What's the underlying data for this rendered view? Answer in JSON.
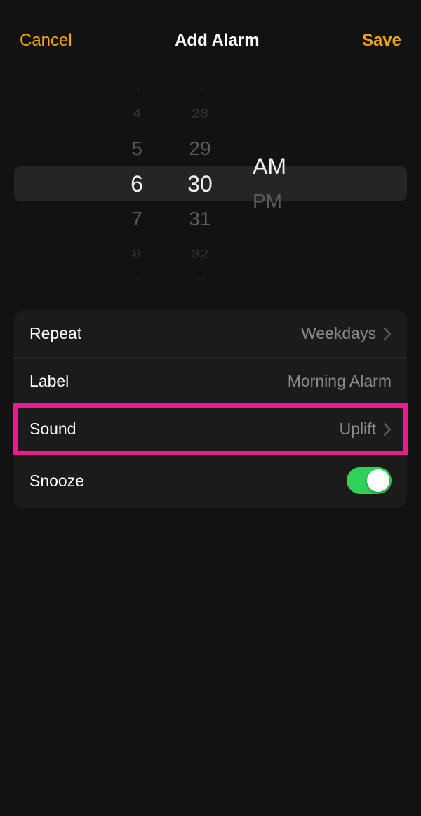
{
  "header": {
    "cancel_label": "Cancel",
    "title": "Add Alarm",
    "save_label": "Save"
  },
  "picker": {
    "hour": {
      "edge_top": "3",
      "far_top": "4",
      "near_top": "5",
      "selected": "6",
      "near_bottom": "7",
      "far_bottom": "8",
      "edge_bottom": "9"
    },
    "minute": {
      "edge_top": "27",
      "far_top": "28",
      "near_top": "29",
      "selected": "30",
      "near_bottom": "31",
      "far_bottom": "32",
      "edge_bottom": "33"
    },
    "ampm": {
      "selected": "AM",
      "other": "PM"
    }
  },
  "settings": {
    "repeat": {
      "label": "Repeat",
      "value": "Weekdays"
    },
    "label_row": {
      "label": "Label",
      "value": "Morning Alarm"
    },
    "sound": {
      "label": "Sound",
      "value": "Uplift"
    },
    "snooze": {
      "label": "Snooze",
      "on": true
    }
  }
}
